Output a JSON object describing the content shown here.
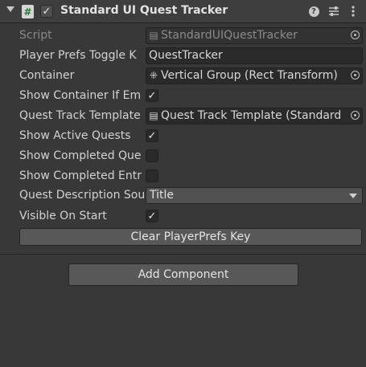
{
  "component": {
    "title": "Standard UI Quest Tracker",
    "enabled": true
  },
  "fields": {
    "script": {
      "label": "Script",
      "value": "StandardUIQuestTracker"
    },
    "player_prefs_toggle_key": {
      "label": "Player Prefs Toggle K",
      "value": "QuestTracker"
    },
    "container": {
      "label": "Container",
      "value": "Vertical Group (Rect Transform)"
    },
    "show_container_if_empty": {
      "label": "Show Container If Em",
      "checked": true
    },
    "quest_track_template": {
      "label": "Quest Track Template",
      "value": "Quest Track Template (Standard"
    },
    "show_active_quests": {
      "label": "Show Active Quests",
      "checked": true
    },
    "show_completed_quests": {
      "label": "Show Completed Que",
      "checked": false
    },
    "show_completed_entries": {
      "label": "Show Completed Entr",
      "checked": false
    },
    "quest_description_source": {
      "label": "Quest Description Sou",
      "value": "Title"
    },
    "visible_on_start": {
      "label": "Visible On Start",
      "checked": true
    }
  },
  "buttons": {
    "clear_prefs": "Clear PlayerPrefs Key",
    "add_component": "Add Component"
  },
  "icons": {
    "help": "help-icon",
    "presets": "presets-icon",
    "menu": "kebab-menu-icon",
    "object_picker": "object-picker-icon"
  }
}
